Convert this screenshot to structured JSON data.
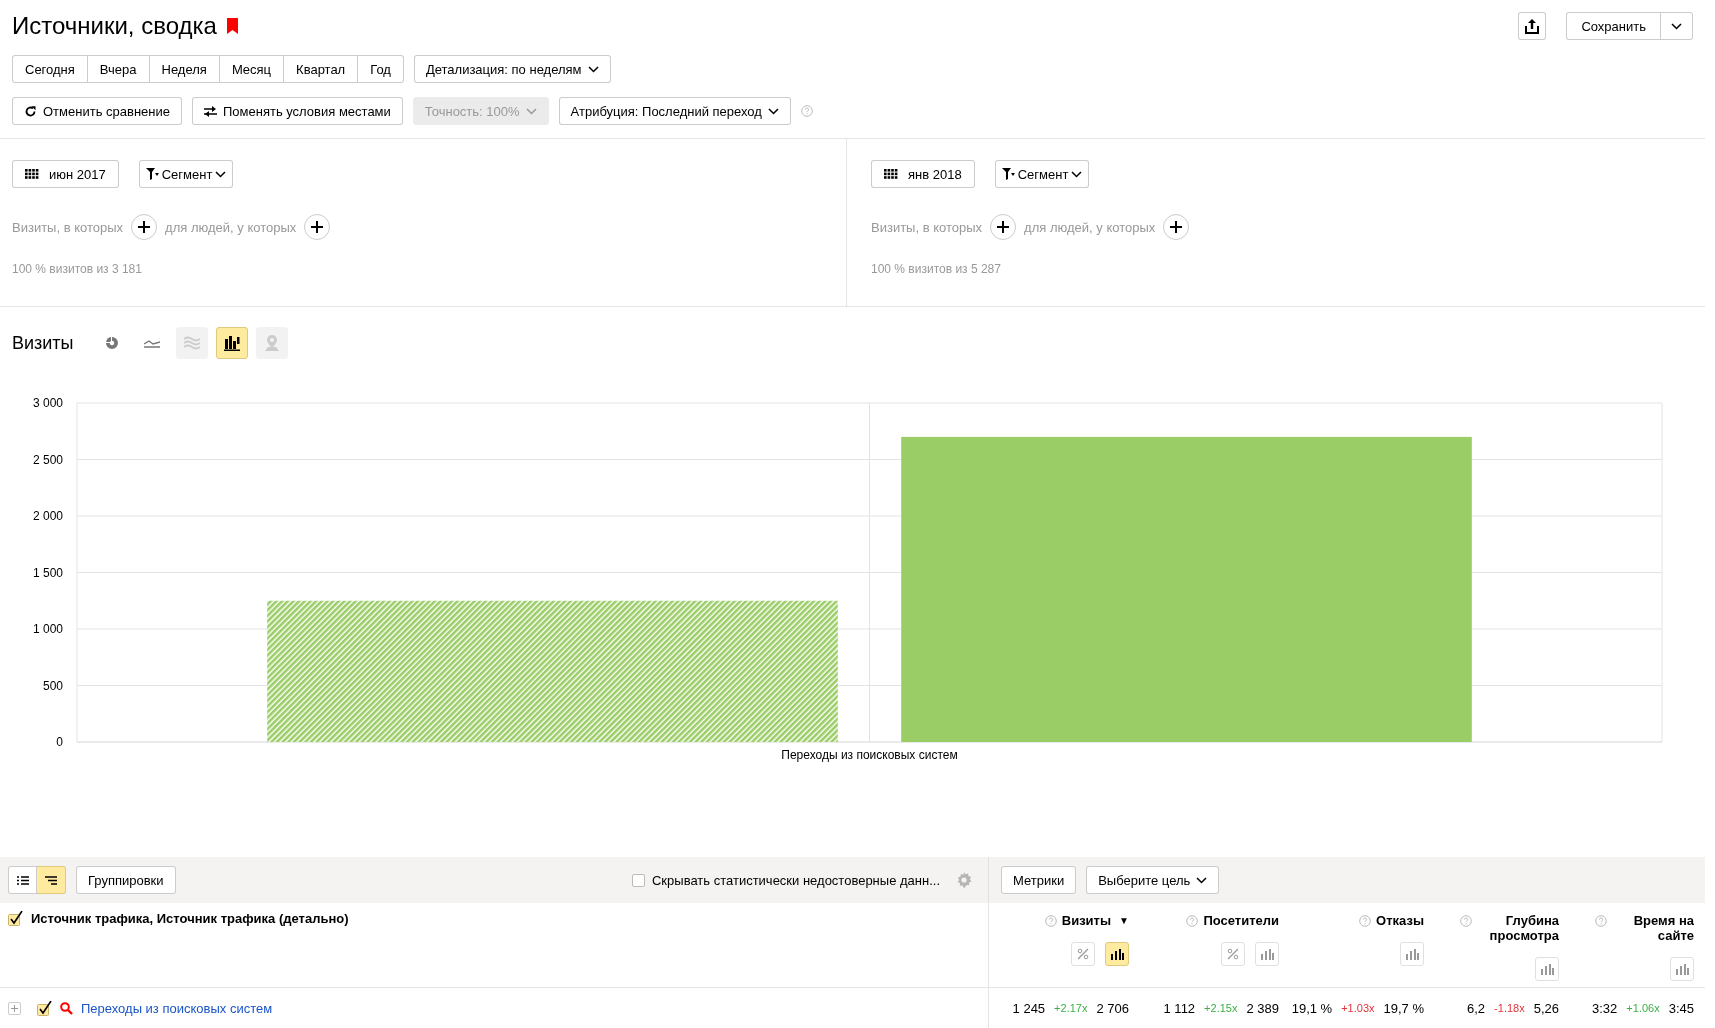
{
  "title": "Источники, сводка",
  "bookmarked": true,
  "save_button": "Сохранить",
  "periods": [
    {
      "label": "Сегодня",
      "selected": false
    },
    {
      "label": "Вчера",
      "selected": false
    },
    {
      "label": "Неделя",
      "selected": false
    },
    {
      "label": "Месяц",
      "selected": false
    },
    {
      "label": "Квартал",
      "selected": false
    },
    {
      "label": "Год",
      "selected": false
    }
  ],
  "detail_dropdown": "Детализация: по неделям",
  "actions": [
    {
      "kind": "reset",
      "label": "Отменить сравнение",
      "disabled": false
    },
    {
      "kind": "swap",
      "label": "Поменять условия местами",
      "disabled": false
    },
    {
      "kind": "dropdown",
      "label": "Точность: 100%",
      "disabled": true
    },
    {
      "kind": "dropdown",
      "label": "Атрибуция: Последний переход",
      "disabled": false
    }
  ],
  "segments": [
    {
      "period": "июн 2017",
      "segment": "Сегмент",
      "visits_condition": "Визиты, в которых",
      "people_condition": "для людей, у которых",
      "coverage": "100 % визитов из 3 181"
    },
    {
      "period": "янв 2018",
      "segment": "Сегмент",
      "visits_condition": "Визиты, в которых",
      "people_condition": "для людей, у которых",
      "coverage": "100 % визитов из 5 287"
    }
  ],
  "chart": {
    "title": "Визиты",
    "types": [
      {
        "kind": "pie",
        "selected": false,
        "disabled": false
      },
      {
        "kind": "line",
        "selected": false,
        "disabled": false
      },
      {
        "kind": "stacked",
        "selected": false,
        "disabled": true
      },
      {
        "kind": "bar",
        "selected": true,
        "disabled": false
      },
      {
        "kind": "map",
        "selected": false,
        "disabled": true
      }
    ],
    "series_styles": [
      {
        "hatched": true
      },
      {
        "hatched": false
      }
    ],
    "chart_data": {
      "type": "bar",
      "categories": [
        "Переходы из поисковых систем"
      ],
      "series": [
        {
          "color": "#9acd66",
          "values": [
            1250
          ]
        },
        {
          "color": "#9acd66",
          "values": [
            2700
          ]
        }
      ],
      "ylim": [
        0,
        3000
      ],
      "grid": true,
      "yticks": [
        {
          "value": 0,
          "label": "0"
        },
        {
          "value": 500,
          "label": "500"
        },
        {
          "value": 1000,
          "label": "1 000"
        },
        {
          "value": 1500,
          "label": "1 500"
        },
        {
          "value": 2000,
          "label": "2 000"
        },
        {
          "value": 2500,
          "label": "2 500"
        },
        {
          "value": 3000,
          "label": "3 000"
        }
      ]
    }
  },
  "table": {
    "view_modes": [
      {
        "kind": "list",
        "selected": false
      },
      {
        "kind": "tree",
        "selected": true
      }
    ],
    "groupings_button": "Группировки",
    "hide_unreliable": {
      "label": "Скрывать статистически недостоверные данн...",
      "checked": false
    },
    "metrics_button": "Метрики",
    "goal_dropdown": "Выберите цель",
    "dimension": {
      "label": "Источник трафика, Источник трафика (детально)",
      "checked": true
    },
    "columns": [
      {
        "label": "Визиты",
        "sorted": true,
        "percent_toggle": true,
        "chart_selected": true
      },
      {
        "label": "Посетители",
        "sorted": false,
        "percent_toggle": true,
        "chart_selected": false
      },
      {
        "label": "Отказы",
        "sorted": false,
        "percent_toggle": false,
        "chart_selected": false
      },
      {
        "label": "Глубина просмотра",
        "sorted": false,
        "percent_toggle": false,
        "chart_selected": false
      },
      {
        "label": "Время на сайте",
        "sorted": false,
        "percent_toggle": false,
        "chart_selected": false
      }
    ],
    "sort_arrow": "▼",
    "rows": [
      {
        "label": "Переходы из поисковых систем",
        "checked": true,
        "expanded": false,
        "cells": [
          {
            "a": "1 245",
            "ratio": "+2.17x",
            "positive": true,
            "b": "2 706"
          },
          {
            "a": "1 112",
            "ratio": "+2.15x",
            "positive": true,
            "b": "2 389"
          },
          {
            "a": "19,1 %",
            "ratio": "+1.03x",
            "positive": false,
            "b": "19,7 %"
          },
          {
            "a": "6,2",
            "ratio": "-1.18x",
            "positive": false,
            "b": "5,26"
          },
          {
            "a": "3:32",
            "ratio": "+1.06x",
            "positive": true,
            "b": "3:45"
          }
        ]
      }
    ]
  }
}
